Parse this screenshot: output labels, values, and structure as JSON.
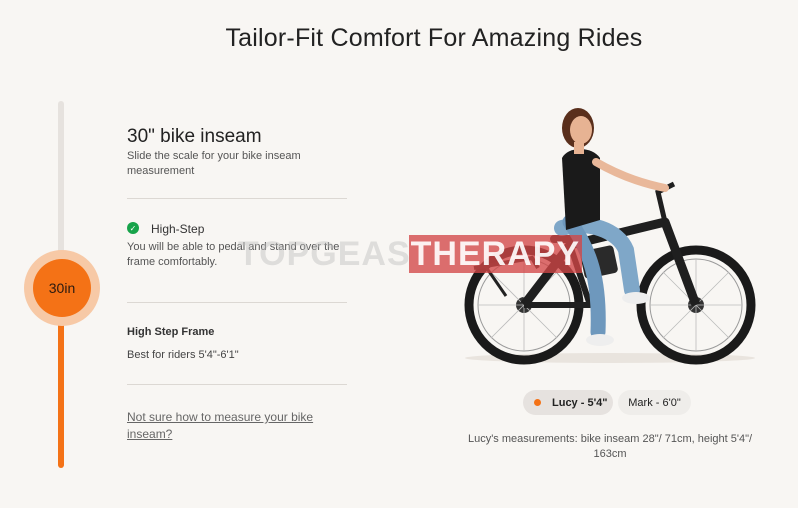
{
  "section": {
    "title": "Tailor-Fit Comfort For Amazing Rides"
  },
  "slider": {
    "value_label": "30in",
    "position": 0.5
  },
  "inseam": {
    "title": "30\" bike inseam",
    "subtitle": "Slide the scale for your bike inseam measurement"
  },
  "step": {
    "icon": "check-circle-icon",
    "title": "High-Step",
    "description": "You will be able to pedal and stand over the frame comfortably."
  },
  "frame": {
    "title": "High Step Frame",
    "description": "Best for riders 5'4\"-6'1\""
  },
  "help_link": "Not sure how to measure your bike inseam?",
  "watermark": {
    "part1": "TOPGEAS",
    "part2": "THERAPY"
  },
  "riders": [
    {
      "label": "Lucy - 5'4\"",
      "selected": true
    },
    {
      "label": "Mark - 6'0\"",
      "selected": false
    }
  ],
  "measurement_note": "Lucy's measurements: bike inseam 28\"/ 71cm, height 5'4\"/ 163cm",
  "colors": {
    "accent": "#f47216",
    "check": "#17a34a",
    "background": "#f8f6f3"
  }
}
